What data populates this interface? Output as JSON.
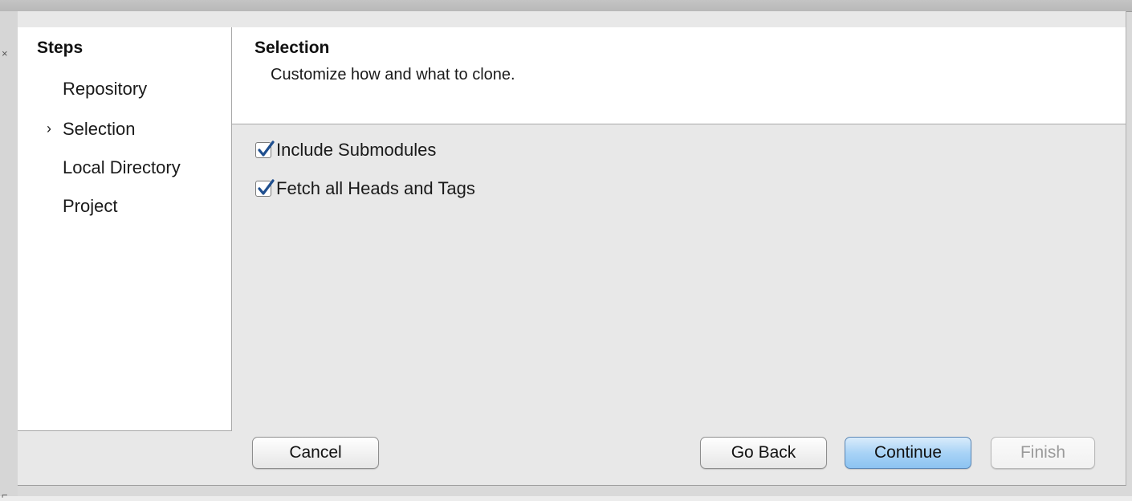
{
  "wizard": {
    "steps_heading": "Steps",
    "steps": [
      {
        "label": "Repository",
        "current": false
      },
      {
        "label": "Selection",
        "current": true
      },
      {
        "label": "Local Directory",
        "current": false
      },
      {
        "label": "Project",
        "current": false
      }
    ],
    "current_marker": "›"
  },
  "page": {
    "title": "Selection",
    "description": "Customize how and what to clone."
  },
  "options": [
    {
      "label": "Include Submodules",
      "checked": true
    },
    {
      "label": "Fetch all Heads and Tags",
      "checked": true
    }
  ],
  "buttons": {
    "cancel": "Cancel",
    "go_back": "Go Back",
    "continue": "Continue",
    "finish": "Finish"
  },
  "colors": {
    "default_button": "#8cc3f1",
    "checkmark": "#1f4f8f"
  }
}
